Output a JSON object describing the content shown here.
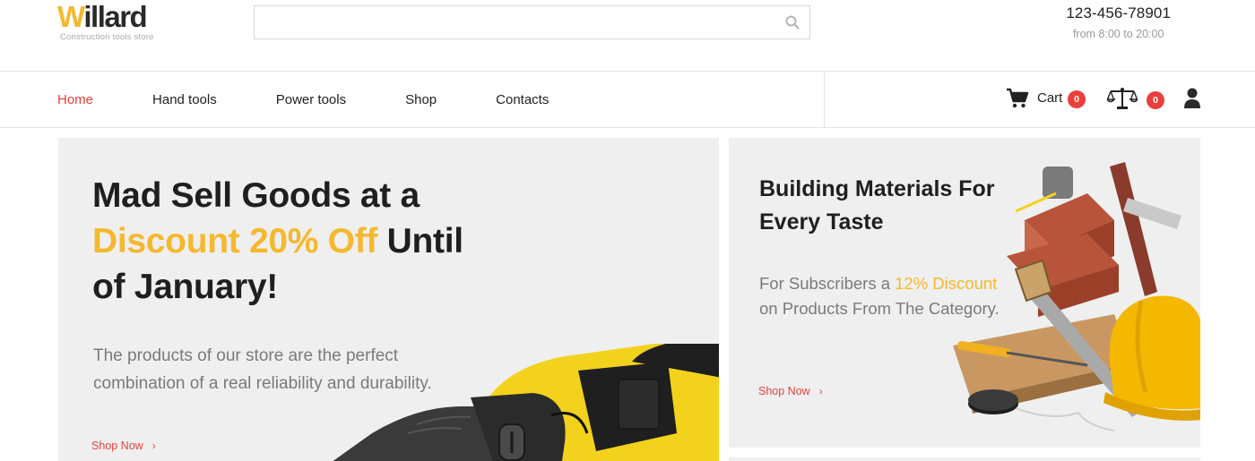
{
  "header": {
    "logo_first_letter": "W",
    "logo_rest": "illard",
    "logo_tagline": "Construction tools store",
    "search_placeholder": "",
    "search_value": "",
    "phone_number": "123-456-78901",
    "phone_hours": "from 8:00 to 20:00"
  },
  "nav": {
    "items": [
      {
        "label": "Home",
        "active": true
      },
      {
        "label": "Hand tools",
        "active": false
      },
      {
        "label": "Power tools",
        "active": false
      },
      {
        "label": "Shop",
        "active": false
      },
      {
        "label": "Contacts",
        "active": false
      }
    ],
    "cart_label": "Cart",
    "cart_count": "0",
    "compare_count": "0"
  },
  "banner_main": {
    "title_line1": "Mad Sell Goods at a",
    "title_accent": "Discount 20% Off",
    "title_after_accent": " Until",
    "title_line3": "of January!",
    "text": "The products of our store are the perfect combination of a real reliability and durability.",
    "link": "Shop Now"
  },
  "banner_side": {
    "title_line1": "Building Materials For",
    "title_line2": "Every Taste",
    "text_before": "For Subscribers a ",
    "text_accent": "12% Discount",
    "text_after": " on Products From The Category.",
    "link": "Shop Now"
  },
  "icons": {
    "search": "search-icon",
    "cart": "cart-icon",
    "compare": "scales-icon",
    "user": "user-icon",
    "chevron": "chevron-right-icon"
  },
  "colors": {
    "accent": "#f5b82e",
    "link_red": "#e8403a",
    "banner_bg": "#efefef",
    "text_dark": "#1f1f1f",
    "text_grey": "#7a7a7a"
  }
}
